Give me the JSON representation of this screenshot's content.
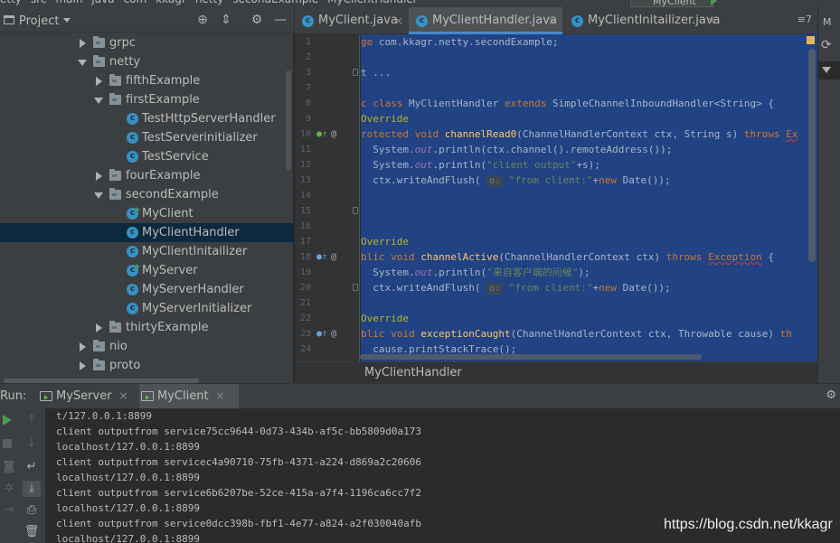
{
  "crumbs": [
    "etty",
    "src",
    "main",
    "java",
    "com",
    "kkagr",
    "netty",
    "secondExample",
    "MyClientHandler"
  ],
  "run_config": "MyClient",
  "project": {
    "title": "Project",
    "tree": [
      {
        "label": "grpc",
        "kind": "folder",
        "state": "collapsed",
        "depth": 1
      },
      {
        "label": "netty",
        "kind": "folder",
        "state": "expanded",
        "depth": 1
      },
      {
        "label": "fifthExample",
        "kind": "folder",
        "state": "collapsed",
        "depth": 2
      },
      {
        "label": "firstExample",
        "kind": "folder",
        "state": "expanded",
        "depth": 2
      },
      {
        "label": "TestHttpServerHandler",
        "kind": "class",
        "depth": 3
      },
      {
        "label": "TestServerinitializer",
        "kind": "class",
        "depth": 3
      },
      {
        "label": "TestService",
        "kind": "class",
        "depth": 3
      },
      {
        "label": "fourExample",
        "kind": "folder",
        "state": "collapsed",
        "depth": 2
      },
      {
        "label": "secondExample",
        "kind": "folder",
        "state": "expanded",
        "depth": 2
      },
      {
        "label": "MyClient",
        "kind": "class-run",
        "depth": 3
      },
      {
        "label": "MyClientHandler",
        "kind": "class",
        "depth": 3,
        "selected": true
      },
      {
        "label": "MyClientInitailizer",
        "kind": "class",
        "depth": 3
      },
      {
        "label": "MyServer",
        "kind": "class-run",
        "depth": 3
      },
      {
        "label": "MyServerHandler",
        "kind": "class",
        "depth": 3
      },
      {
        "label": "MyServerInitializer",
        "kind": "class",
        "depth": 3
      },
      {
        "label": "thirtyExample",
        "kind": "folder",
        "state": "collapsed",
        "depth": 2
      },
      {
        "label": "nio",
        "kind": "folder",
        "state": "collapsed",
        "depth": 1
      },
      {
        "label": "proto",
        "kind": "folder",
        "state": "collapsed",
        "depth": 1
      }
    ]
  },
  "tabs": [
    {
      "label": "MyClient.java",
      "active": false
    },
    {
      "label": "MyClientHandler.java",
      "active": true
    },
    {
      "label": "MyClientInitailizer.java",
      "active": false
    }
  ],
  "tabs_more": "≡7",
  "editor": {
    "line_numbers": [
      "1",
      "2",
      "3",
      "7",
      "8",
      "9",
      "10",
      "11",
      "12",
      "13",
      "14",
      "15",
      "16",
      "17",
      "18",
      "19",
      "20",
      "21",
      "22",
      "23",
      "24"
    ],
    "lines": [
      [
        {
          "t": "ge ",
          "c": "kw"
        },
        {
          "t": "com.kkagr.netty.secondExample;",
          "c": ""
        }
      ],
      [],
      [
        {
          "t": "t ...",
          "c": ""
        }
      ],
      [],
      [
        {
          "t": "c ",
          "c": "kw"
        },
        {
          "t": "class ",
          "c": "kw"
        },
        {
          "t": "MyClientHandler ",
          "c": ""
        },
        {
          "t": "extends ",
          "c": "kw"
        },
        {
          "t": "SimpleChannelInboundHandler<String> {",
          "c": ""
        }
      ],
      [
        {
          "t": "Override",
          "c": "ann"
        }
      ],
      [
        {
          "t": "rotected ",
          "c": "kw"
        },
        {
          "t": "void ",
          "c": "kw"
        },
        {
          "t": "channelRead0",
          "c": "fn"
        },
        {
          "t": "(ChannelHandlerContext ctx, String s) ",
          "c": ""
        },
        {
          "t": "throws ",
          "c": "kw"
        },
        {
          "t": "Ex",
          "c": "err"
        }
      ],
      [
        {
          "t": "  System.",
          "c": ""
        },
        {
          "t": "out",
          "c": "fld"
        },
        {
          "t": ".println(ctx.channel().remoteAddress());",
          "c": ""
        }
      ],
      [
        {
          "t": "  System.",
          "c": ""
        },
        {
          "t": "out",
          "c": "fld"
        },
        {
          "t": ".println(",
          "c": ""
        },
        {
          "t": "\"client output\"",
          "c": "st"
        },
        {
          "t": "+s);",
          "c": ""
        }
      ],
      [
        {
          "t": "  ctx.writeAndFlush( ",
          "c": ""
        },
        {
          "t": "o:",
          "c": "hint"
        },
        {
          "t": " ",
          "c": ""
        },
        {
          "t": "\"from client:\"",
          "c": "st"
        },
        {
          "t": "+",
          "c": ""
        },
        {
          "t": "new ",
          "c": "kw"
        },
        {
          "t": "Date());",
          "c": ""
        }
      ],
      [],
      [],
      [],
      [
        {
          "t": "Override",
          "c": "ann"
        }
      ],
      [
        {
          "t": "blic ",
          "c": "kw"
        },
        {
          "t": "void ",
          "c": "kw"
        },
        {
          "t": "channelActive",
          "c": "fn"
        },
        {
          "t": "(ChannelHandlerContext ctx) ",
          "c": ""
        },
        {
          "t": "throws ",
          "c": "kw"
        },
        {
          "t": "Exception",
          "c": "err"
        },
        {
          "t": " {",
          "c": ""
        }
      ],
      [
        {
          "t": "  System.",
          "c": ""
        },
        {
          "t": "out",
          "c": "fld"
        },
        {
          "t": ".println(",
          "c": ""
        },
        {
          "t": "\"来自客户端的问候\"",
          "c": "st"
        },
        {
          "t": ");",
          "c": ""
        }
      ],
      [
        {
          "t": "  ctx.writeAndFlush( ",
          "c": ""
        },
        {
          "t": "o:",
          "c": "hint"
        },
        {
          "t": " ",
          "c": ""
        },
        {
          "t": "\"from client:\"",
          "c": "st"
        },
        {
          "t": "+",
          "c": ""
        },
        {
          "t": "new ",
          "c": "kw"
        },
        {
          "t": "Date());",
          "c": ""
        }
      ],
      [],
      [
        {
          "t": "Override",
          "c": "ann"
        }
      ],
      [
        {
          "t": "blic ",
          "c": "kw"
        },
        {
          "t": "void ",
          "c": "kw"
        },
        {
          "t": "exceptionCaught",
          "c": "fn"
        },
        {
          "t": "(ChannelHandlerContext ctx, Throwable cause) ",
          "c": ""
        },
        {
          "t": "th",
          "c": "kw"
        }
      ],
      [
        {
          "t": "  cause.printStackTrace();",
          "c": ""
        }
      ]
    ]
  },
  "editor_breadcrumb": "MyClientHandler",
  "right_strip": {
    "label": "M"
  },
  "run": {
    "label": "Run:",
    "tabs": [
      {
        "label": "MyServer",
        "active": false
      },
      {
        "label": "MyClient",
        "active": true
      }
    ],
    "output": [
      "t/127.0.0.1:8899",
      "client outputfrom service75cc9644-0d73-434b-af5c-bb5809d0a173",
      "localhost/127.0.0.1:8899",
      "client outputfrom servicec4a90710-75fb-4371-a224-d869a2c20606",
      "localhost/127.0.0.1:8899",
      "client outputfrom service6b6207be-52ce-415a-a7f4-1196ca6cc7f2",
      "localhost/127.0.0.1:8899",
      "client outputfrom service0dcc398b-fbf1-4e77-a824-a2f030040afb",
      "localhost/127.0.0.1:8899"
    ]
  },
  "watermark": "https://blog.csdn.net/kkagr"
}
